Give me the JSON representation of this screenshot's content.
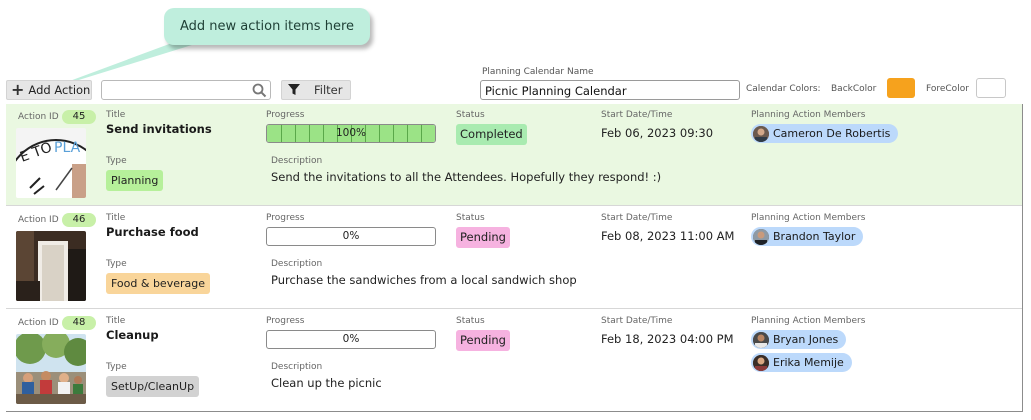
{
  "callout": {
    "text": "Add new action items here"
  },
  "toolbar": {
    "add_action_label": "Add Action",
    "search_value": "",
    "filter_label": "Filter",
    "calendar_name_label": "Planning Calendar Name",
    "calendar_name_value": "Picnic Planning Calendar",
    "calendar_colors_label": "Calendar Colors:",
    "backcolor_label": "BackColor",
    "forecolor_label": "ForeColor",
    "backcolor": "#f6a21d",
    "forecolor": "#ffffff"
  },
  "labels": {
    "action_id": "Action ID",
    "title": "Title",
    "type": "Type",
    "progress": "Progress",
    "status": "Status",
    "start_date": "Start Date/Time",
    "description": "Description",
    "members": "Planning Action Members"
  },
  "rows": [
    {
      "id": "45",
      "title": "Send invitations",
      "type": "Planning",
      "type_color": "#b6f09a",
      "progress": 100,
      "progress_text": "100%",
      "status": "Completed",
      "status_color": "#a9ebb0",
      "start": "Feb 06, 2023 09:30",
      "description": "Send the invitations to all the Attendees. Hopefully they respond! :)",
      "image": "clock-invite-image",
      "members": [
        "Cameron De Robertis"
      ]
    },
    {
      "id": "46",
      "title": "Purchase food",
      "type": "Food & beverage",
      "type_color": "#f9d59a",
      "progress": 0,
      "progress_text": "0%",
      "status": "Pending",
      "status_color": "#f6b2e0",
      "start": "Feb 08, 2023 11:00 AM",
      "description": "Purchase the sandwiches from a local sandwich shop",
      "image": "waiter-food-image",
      "members": [
        "Brandon Taylor"
      ]
    },
    {
      "id": "48",
      "title": "Cleanup",
      "type": "SetUp/CleanUp",
      "type_color": "#d2d2d2",
      "progress": 0,
      "progress_text": "0%",
      "status": "Pending",
      "status_color": "#f6b2e0",
      "start": "Feb 18, 2023 04:00 PM",
      "description": "Clean up the picnic",
      "image": "park-picnic-image",
      "members": [
        "Bryan Jones",
        "Erika Memije"
      ]
    }
  ]
}
